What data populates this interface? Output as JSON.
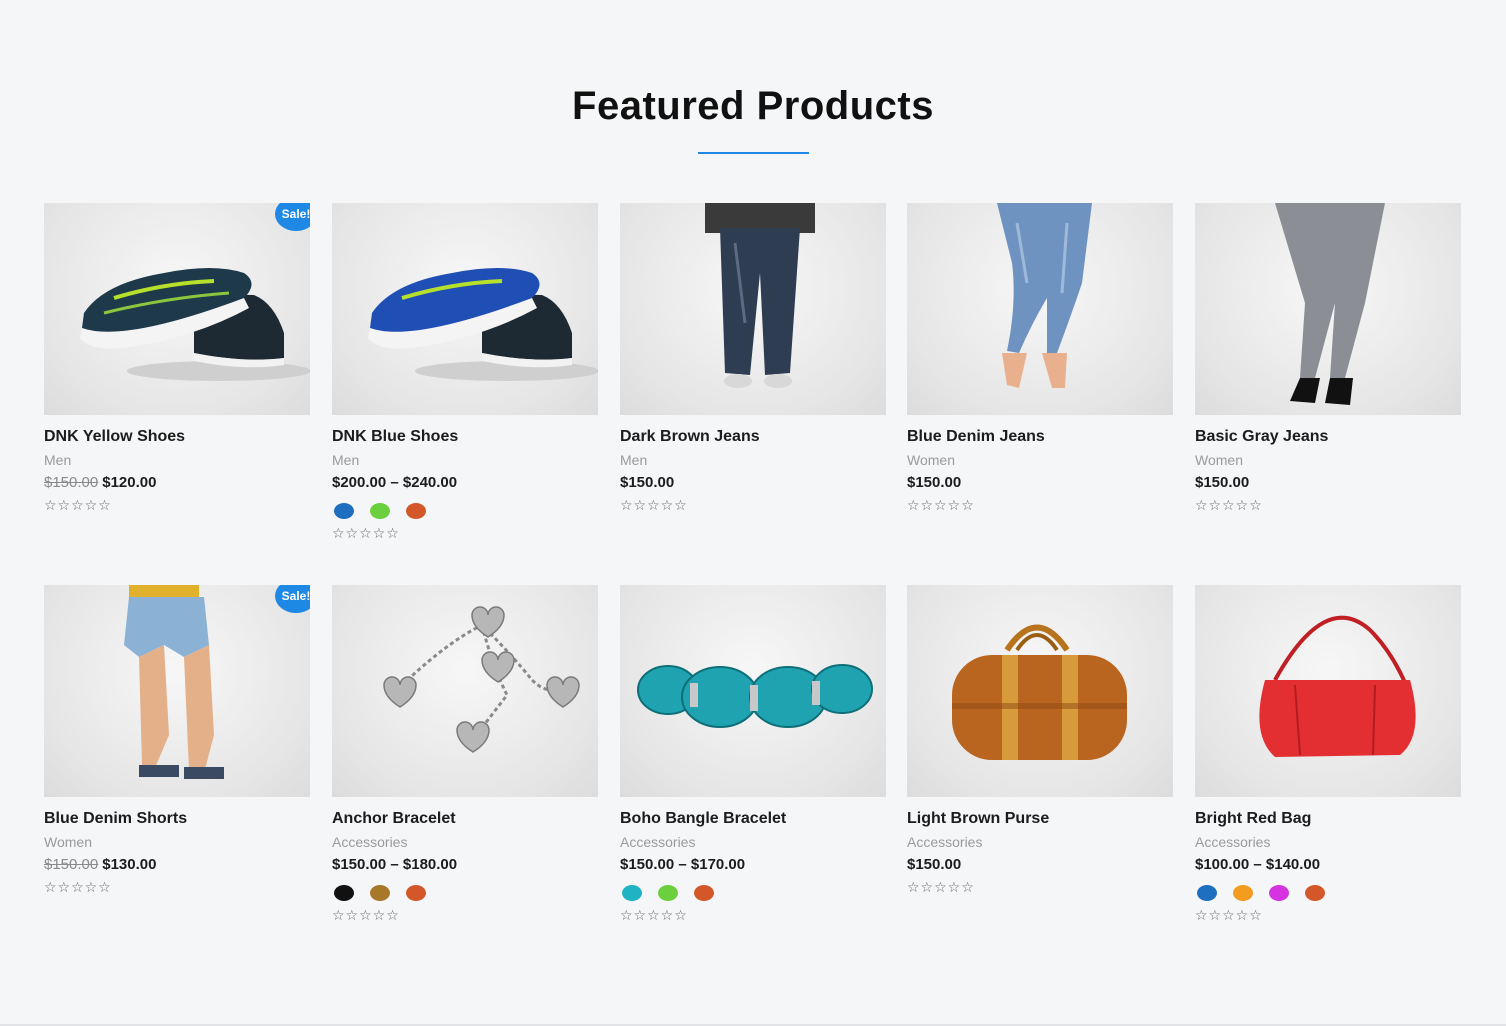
{
  "section": {
    "title": "Featured Products"
  },
  "colors": {
    "accent": "#1e88e5"
  },
  "products": [
    {
      "title": "DNK Yellow Shoes",
      "category": "Men",
      "old_price": "$150.00",
      "price": "$120.00",
      "sale": "Sale!",
      "swatches": [],
      "rating": "☆☆☆☆☆",
      "image": "sneaker-yellow"
    },
    {
      "title": "DNK Blue Shoes",
      "category": "Men",
      "old_price": "",
      "price": "$200.00 – $240.00",
      "sale": "",
      "swatches": [
        "#1e6fbf",
        "#6ccf3d",
        "#d4572a"
      ],
      "rating": "☆☆☆☆☆",
      "image": "sneaker-blue"
    },
    {
      "title": "Dark Brown Jeans",
      "category": "Men",
      "old_price": "",
      "price": "$150.00",
      "sale": "",
      "swatches": [],
      "rating": "☆☆☆☆☆",
      "image": "jeans-dark"
    },
    {
      "title": "Blue Denim Jeans",
      "category": "Women",
      "old_price": "",
      "price": "$150.00",
      "sale": "",
      "swatches": [],
      "rating": "☆☆☆☆☆",
      "image": "jeans-blue"
    },
    {
      "title": "Basic Gray Jeans",
      "category": "Women",
      "old_price": "",
      "price": "$150.00",
      "sale": "",
      "swatches": [],
      "rating": "☆☆☆☆☆",
      "image": "jeans-gray"
    },
    {
      "title": "Blue Denim Shorts",
      "category": "Women",
      "old_price": "$150.00",
      "price": "$130.00",
      "sale": "Sale!",
      "swatches": [],
      "rating": "☆☆☆☆☆",
      "image": "shorts"
    },
    {
      "title": "Anchor Bracelet",
      "category": "Accessories",
      "old_price": "",
      "price": "$150.00 – $180.00",
      "sale": "",
      "swatches": [
        "#111111",
        "#a8782a",
        "#d4572a"
      ],
      "rating": "☆☆☆☆☆",
      "image": "bracelet-silver"
    },
    {
      "title": "Boho Bangle Bracelet",
      "category": "Accessories",
      "old_price": "",
      "price": "$150.00 – $170.00",
      "sale": "",
      "swatches": [
        "#1fb3c4",
        "#6ccf3d",
        "#d4572a"
      ],
      "rating": "☆☆☆☆☆",
      "image": "bracelet-turquoise"
    },
    {
      "title": "Light Brown Purse",
      "category": "Accessories",
      "old_price": "",
      "price": "$150.00",
      "sale": "",
      "swatches": [],
      "rating": "☆☆☆☆☆",
      "image": "purse-brown"
    },
    {
      "title": "Bright Red Bag",
      "category": "Accessories",
      "old_price": "",
      "price": "$100.00 – $140.00",
      "sale": "",
      "swatches": [
        "#1e6fbf",
        "#f39c1f",
        "#d633e0",
        "#d4572a"
      ],
      "rating": "☆☆☆☆☆",
      "image": "bag-red"
    }
  ]
}
